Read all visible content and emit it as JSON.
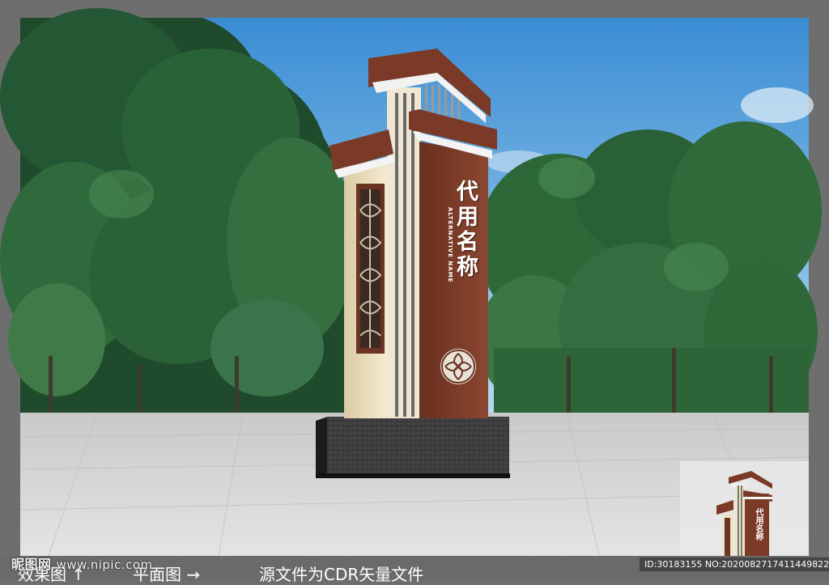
{
  "sign": {
    "title": "代用名称",
    "subtitle": "ALTERNATIVE NAME"
  },
  "footer": {
    "watermark_logo": "昵图网",
    "watermark_url": "www.nipic.com",
    "caption_effect": "效果图 ↑",
    "caption_plan": "平面图 →",
    "caption_source": "源文件为CDR矢量文件",
    "id_tag": "ID:30183155 NO:20200827174114498222"
  },
  "colors": {
    "sky_top": "#3d8fd6",
    "sky_bottom": "#a9d6ee",
    "tree_dark": "#1f4d2c",
    "tree_mid": "#3f7a45",
    "plaza": "#d8d8d8",
    "sign_brown": "#7a3b28",
    "sign_cream": "#efe4c6",
    "base_granite": "#3a3a3a",
    "frame": "#6e6e6e"
  }
}
